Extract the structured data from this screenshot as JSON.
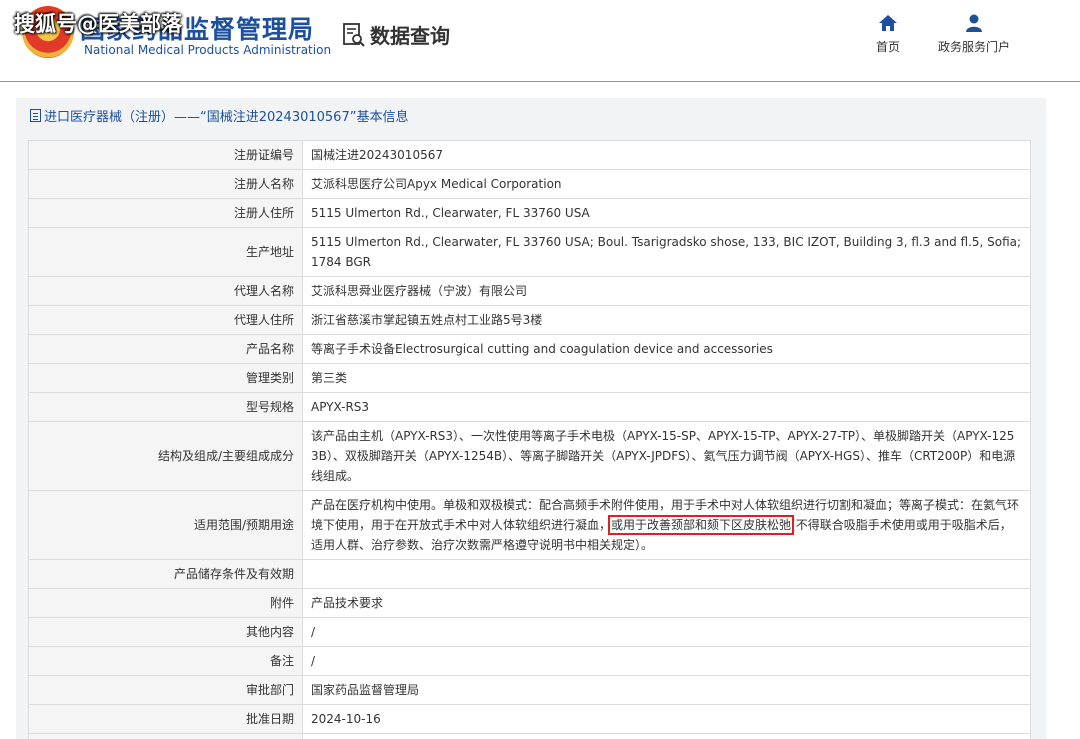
{
  "header": {
    "org_name_cn": "国家药品监督管理局",
    "org_name_en": "National Medical Products Administration",
    "watermark": "搜狐号@医美部落",
    "page_title": "数据查询",
    "nav": {
      "home_label": "首页",
      "portal_label": "政务服务门户"
    }
  },
  "panel": {
    "title": "进口医疗器械（注册）——“国械注进20243010567”基本信息"
  },
  "rows": [
    {
      "label": "注册证编号",
      "value": "国械注进20243010567"
    },
    {
      "label": "注册人名称",
      "value": "艾派科思医疗公司Apyx Medical Corporation"
    },
    {
      "label": "注册人住所",
      "value": "5115 Ulmerton Rd., Clearwater, FL 33760 USA"
    },
    {
      "label": "生产地址",
      "value": "5115 Ulmerton Rd., Clearwater, FL 33760 USA; Boul. Tsarigradsko shose, 133, BIC IZOT, Building 3, fl.3 and fl.5, Sofia; 1784 BGR"
    },
    {
      "label": "代理人名称",
      "value": "艾派科思舜业医疗器械（宁波）有限公司"
    },
    {
      "label": "代理人住所",
      "value": "浙江省慈溪市掌起镇五姓点村工业路5号3楼"
    },
    {
      "label": "产品名称",
      "value": "等离子手术设备Electrosurgical cutting and coagulation device and accessories"
    },
    {
      "label": "管理类别",
      "value": "第三类"
    },
    {
      "label": "型号规格",
      "value": "APYX-RS3"
    },
    {
      "label": "结构及组成/主要组成成分",
      "value": "该产品由主机（APYX-RS3）、一次性使用等离子手术电极（APYX-15-SP、APYX-15-TP、APYX-27-TP）、单极脚踏开关（APYX-1253B）、双极脚踏开关（APYX-1254B）、等离子脚踏开关（APYX-JPDFS）、氦气压力调节阀（APYX-HGS）、推车（CRT200P）和电源线组成。"
    },
    {
      "label": "适用范围/预期用途",
      "value_before": "产品在医疗机构中使用。单极和双极模式：配合高频手术附件使用，用于手术中对人体软组织进行切割和凝血；等离子模式：在氦气环境下使用，用于在开放式手术中对人体软组织进行凝血，",
      "value_highlight": "或用于改善颈部和颏下区皮肤松弛",
      "value_after": "(不得联合吸脂手术使用或用于吸脂术后，适用人群、治疗参数、治疗次数需严格遵守说明书中相关规定）。"
    },
    {
      "label": "产品储存条件及有效期",
      "value": ""
    },
    {
      "label": "附件",
      "value": "产品技术要求"
    },
    {
      "label": "其他内容",
      "value": "/"
    },
    {
      "label": "备注",
      "value": "/"
    },
    {
      "label": "审批部门",
      "value": "国家药品监督管理局"
    },
    {
      "label": "批准日期",
      "value": "2024-10-16"
    },
    {
      "label": "",
      "value": ""
    }
  ]
}
